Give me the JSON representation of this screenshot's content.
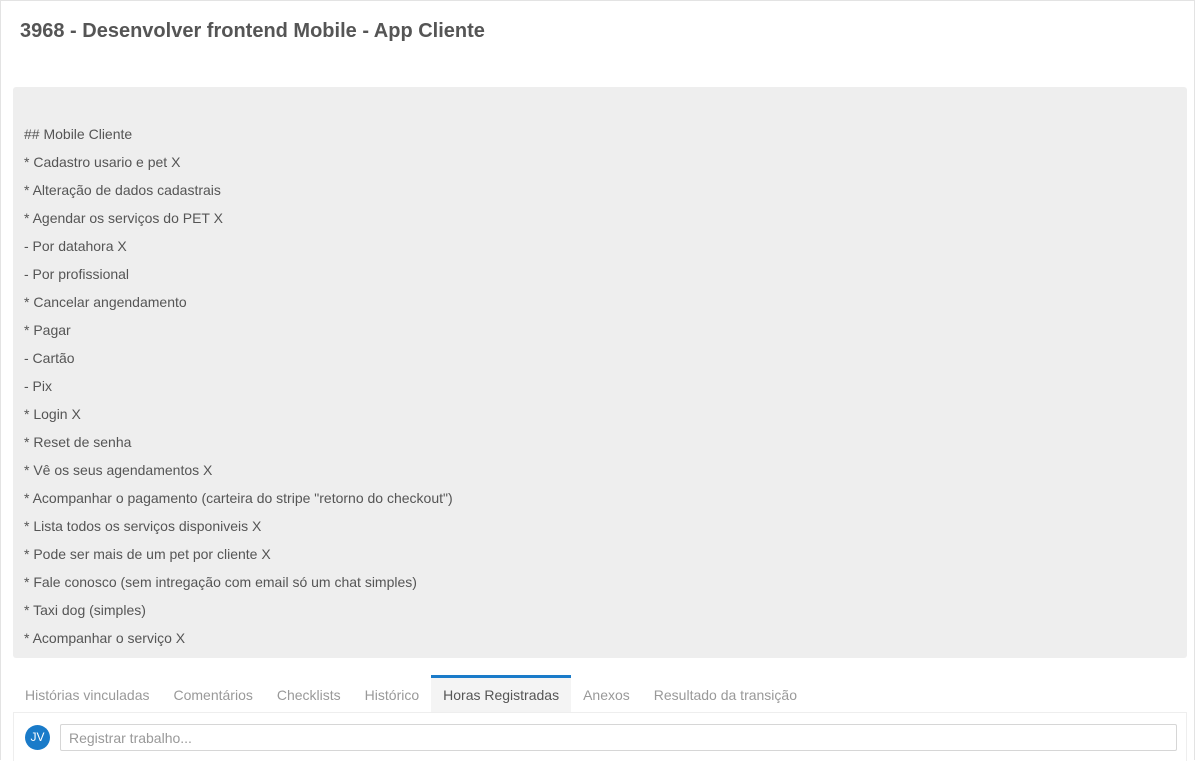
{
  "task": {
    "title": "3968 - Desenvolver frontend Mobile - App Cliente"
  },
  "description": {
    "lines": [
      "## Mobile Cliente",
      "* Cadastro usario e pet X",
      "* Alteração de dados cadastrais",
      "* Agendar os serviços do PET X",
      "- Por datahora X",
      "- Por profissional",
      "* Cancelar angendamento",
      "* Pagar",
      "- Cartão",
      "- Pix",
      "* Login X",
      "* Reset de senha",
      "* Vê os seus agendamentos X",
      "* Acompanhar o pagamento (carteira do stripe \"retorno do checkout\")",
      "* Lista todos os serviços disponiveis X",
      "* Pode ser mais de um pet por cliente X",
      "* Fale conosco (sem intregação com email só um chat simples)",
      "* Taxi dog (simples)",
      "* Acompanhar o serviço X"
    ]
  },
  "tabs": [
    {
      "label": "Histórias vinculadas",
      "active": false
    },
    {
      "label": "Comentários",
      "active": false
    },
    {
      "label": "Checklists",
      "active": false
    },
    {
      "label": "Histórico",
      "active": false
    },
    {
      "label": "Horas Registradas",
      "active": true
    },
    {
      "label": "Anexos",
      "active": false
    },
    {
      "label": "Resultado da transição",
      "active": false
    }
  ],
  "worklog": {
    "avatar_initials": "JV",
    "input_value": "",
    "input_placeholder": "Registrar trabalho..."
  },
  "colors": {
    "accent": "#1a7bc9",
    "description_bg": "#eeeeee",
    "text": "#555555",
    "muted_text": "#999999"
  }
}
